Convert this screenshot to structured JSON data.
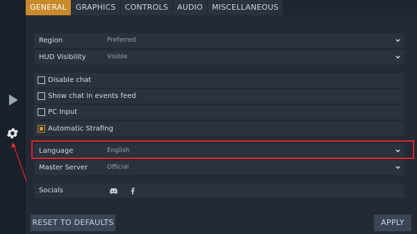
{
  "tabs": [
    {
      "label": "GENERAL",
      "active": true
    },
    {
      "label": "GRAPHICS",
      "active": false
    },
    {
      "label": "CONTROLS",
      "active": false
    },
    {
      "label": "AUDIO",
      "active": false
    },
    {
      "label": "MISCELLANEOUS",
      "active": false
    }
  ],
  "settings": {
    "region": {
      "label": "Region",
      "value": "Preferred"
    },
    "hud": {
      "label": "HUD Visibility",
      "value": "Visible"
    },
    "disable_chat": {
      "label": "Disable chat",
      "checked": false
    },
    "show_chat_feed": {
      "label": "Show chat in events feed",
      "checked": false
    },
    "pc_input": {
      "label": "PC Input",
      "checked": false
    },
    "auto_strafing": {
      "label": "Automatic Strafing",
      "checked": true
    },
    "language": {
      "label": "Language",
      "value": "English"
    },
    "master_server": {
      "label": "Master Server",
      "value": "Official"
    },
    "socials": {
      "label": "Socials",
      "icons": [
        "discord-icon",
        "facebook-icon"
      ]
    }
  },
  "buttons": {
    "reset": "RESET TO DEFAULTS",
    "apply": "APPLY"
  },
  "sidebar": {
    "icons": [
      "play-icon",
      "gear-icon"
    ]
  },
  "colors": {
    "accent": "#c98a2c",
    "highlight": "#e0262e",
    "background": "#1f2631",
    "row": "#2a323d"
  }
}
